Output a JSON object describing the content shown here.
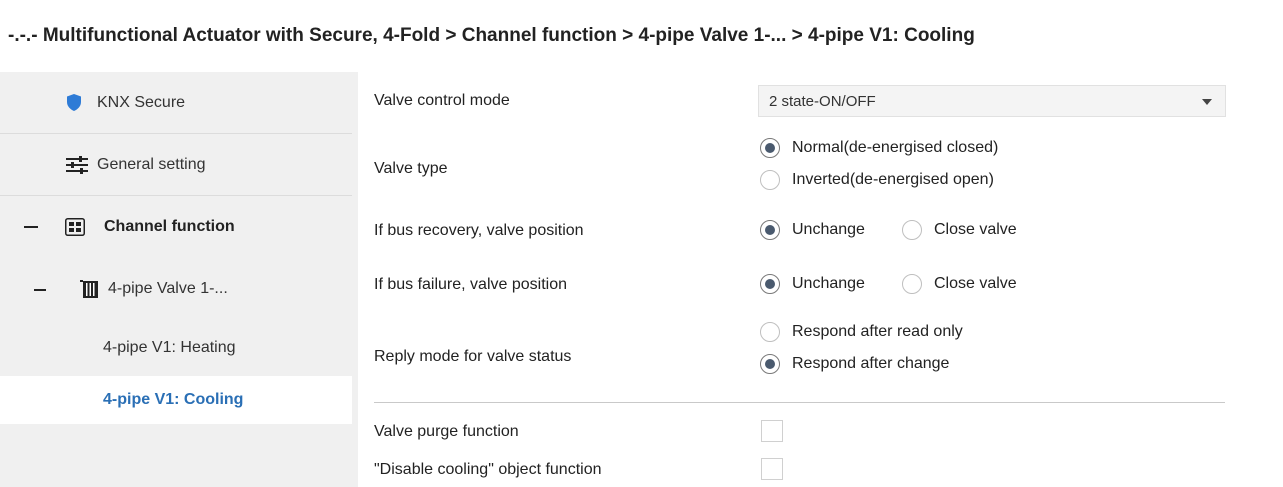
{
  "breadcrumb": "-.-.- Multifunctional Actuator with Secure, 4-Fold > Channel function > 4-pipe Valve 1-... > 4-pipe V1: Cooling",
  "sidebar": {
    "items": [
      {
        "label": "KNX Secure",
        "icon": "shield-icon"
      },
      {
        "label": "General setting",
        "icon": "sliders-icon"
      },
      {
        "label": "Channel function",
        "icon": "grid-icon",
        "expanded": true
      },
      {
        "label": "4-pipe Valve 1-...",
        "icon": "valve-icon",
        "expanded": true
      },
      {
        "label": "4-pipe V1: Heating"
      },
      {
        "label": "4-pipe V1: Cooling",
        "selected": true
      }
    ]
  },
  "params": {
    "valve_control_mode": {
      "label": "Valve control mode",
      "value": "2 state-ON/OFF"
    },
    "valve_type": {
      "label": "Valve type",
      "options": [
        "Normal(de-energised closed)",
        "Inverted(de-energised open)"
      ],
      "selected": 0
    },
    "bus_recovery": {
      "label": "If bus recovery, valve position",
      "options": [
        "Unchange",
        "Close valve"
      ],
      "selected": 0
    },
    "bus_failure": {
      "label": "If bus failure, valve position",
      "options": [
        "Unchange",
        "Close valve"
      ],
      "selected": 0
    },
    "reply_mode": {
      "label": "Reply mode for valve status",
      "options": [
        "Respond after read only",
        "Respond after change"
      ],
      "selected": 1
    },
    "valve_purge": {
      "label": "Valve purge function",
      "checked": false
    },
    "disable_cooling": {
      "label": "\"Disable cooling\" object function",
      "checked": false
    }
  },
  "colors": {
    "accent": "#2a6fb5",
    "shield": "#2e7bd6",
    "sidebar_bg": "#f0f0f0",
    "radio_dot": "#4a5a6e"
  }
}
